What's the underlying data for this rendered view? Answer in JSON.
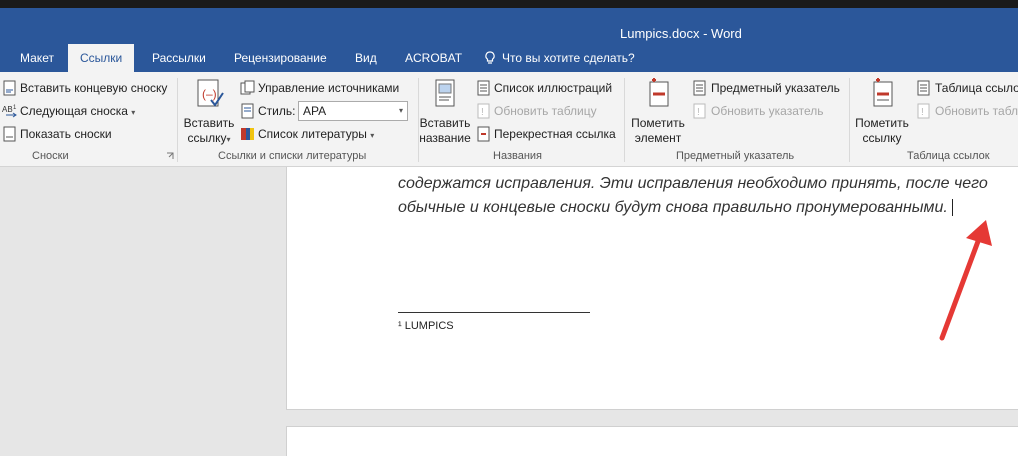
{
  "window": {
    "title": "Lumpics.docx - Word"
  },
  "tabs": [
    {
      "label": "Макет"
    },
    {
      "label": "Ссылки",
      "active": true
    },
    {
      "label": "Рассылки"
    },
    {
      "label": "Рецензирование"
    },
    {
      "label": "Вид"
    },
    {
      "label": "ACROBAT"
    }
  ],
  "tellme": {
    "label": "Что вы хотите сделать?",
    "icon": "lightbulb-icon"
  },
  "ribbon": {
    "footnotes": {
      "insert_endnote": "Вставить концевую сноску",
      "next_footnote": "Следующая сноска",
      "show_notes": "Показать сноски",
      "group_label": "Сноски"
    },
    "citations": {
      "insert_citation_line1": "Вставить",
      "insert_citation_line2": "ссылку",
      "manage_sources": "Управление источниками",
      "style_label": "Стиль:",
      "style_value": "APA",
      "bibliography": "Список литературы",
      "group_label": "Ссылки и списки литературы"
    },
    "captions": {
      "insert_caption_line1": "Вставить",
      "insert_caption_line2": "название",
      "table_of_figures": "Список иллюстраций",
      "update_table": "Обновить таблицу",
      "cross_reference": "Перекрестная ссылка",
      "group_label": "Названия"
    },
    "index": {
      "mark_entry_line1": "Пометить",
      "mark_entry_line2": "элемент",
      "insert_index": "Предметный указатель",
      "update_index": "Обновить указатель",
      "group_label": "Предметный указатель"
    },
    "toa": {
      "mark_citation_line1": "Пометить",
      "mark_citation_line2": "ссылку",
      "insert_toa": "Таблица ссылок",
      "update_table": "Обновить табл",
      "group_label": "Таблица ссылок"
    }
  },
  "document": {
    "line1": "содержатся исправления. Эти исправления необходимо принять, после чего",
    "line2": "обычные и концевые сноски будут снова правильно пронумерованными.",
    "footnote": "¹ LUMPICS"
  },
  "colors": {
    "accent": "#2b579a",
    "arrow": "#e53935"
  }
}
